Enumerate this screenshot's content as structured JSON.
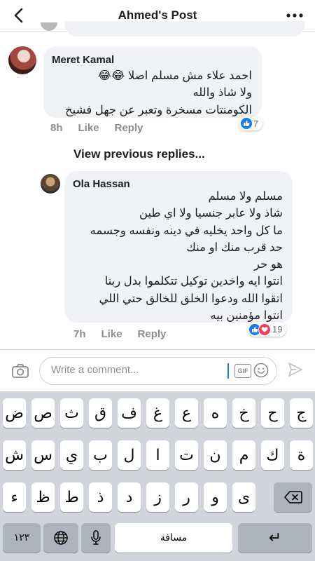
{
  "header": {
    "title": "Ahmed's Post"
  },
  "comments": [
    {
      "author": "Meret Kamal",
      "lines": [
        "احمد علاء مش مسلم اصلا 😂😂",
        "ولا شاذ والله",
        "الكومنتات مسخرة وتعبر عن جهل فشيخ"
      ],
      "time": "8h",
      "like_label": "Like",
      "reply_label": "Reply",
      "reaction_count": "7"
    },
    {
      "author": "Ola Hassan",
      "lines": [
        "مسلم ولا مسلم",
        "شاذ ولا عابر جنسيا ولا اي طين",
        "ما كل واحد يخليه في دينه ونفسه وجسمه",
        "حد قرب منك او منك",
        "هو حر",
        "انتوا ايه واخدين توكيل تتكلموا بدل ربنا",
        "اتقوا الله ودعوا الخلق للخالق حتي اللي",
        "انتوا مؤمنين بيه"
      ],
      "time": "7h",
      "like_label": "Like",
      "reply_label": "Reply",
      "reaction_count": "19"
    }
  ],
  "view_previous": "View previous replies...",
  "composer": {
    "placeholder": "Write a comment...",
    "gif_label": "GIF"
  },
  "keyboard": {
    "row1": [
      "ض",
      "ص",
      "ث",
      "ق",
      "ف",
      "غ",
      "ع",
      "ه",
      "خ",
      "ح",
      "ج"
    ],
    "row2": [
      "ش",
      "س",
      "ي",
      "ب",
      "ل",
      "ا",
      "ت",
      "ن",
      "م",
      "ك",
      "ة"
    ],
    "row3": [
      "ء",
      "ظ",
      "ط",
      "ذ",
      "د",
      "ز",
      "ر",
      "و",
      "ى"
    ],
    "numbers_key": "١٢٣",
    "space_key": "مسافة",
    "return_key": "↵"
  },
  "colors": {
    "accent": "#1877f2",
    "love": "#f33e58",
    "bubble": "#f0f2f5",
    "muted": "#8a8d91"
  }
}
